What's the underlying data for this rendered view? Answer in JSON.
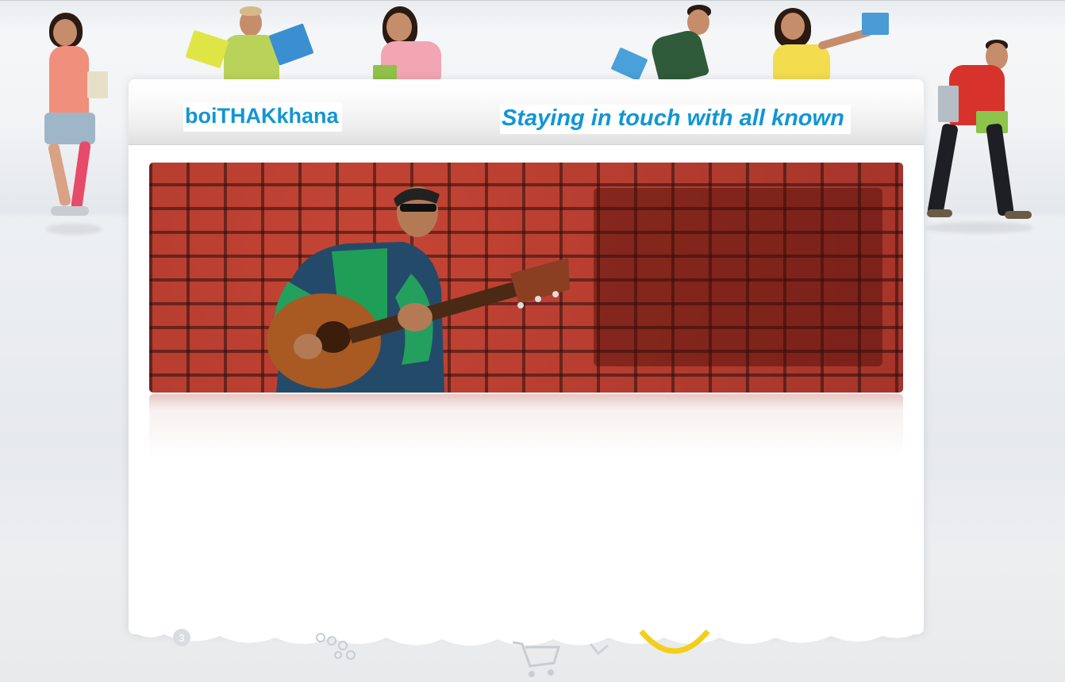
{
  "site": {
    "title": "boiTHAKkhana",
    "tagline": "Staying in touch with all known"
  },
  "colors": {
    "accent": "#1296d4",
    "brick": "#a9362a",
    "background": "#eceef0",
    "card": "#ffffff"
  },
  "banner": {
    "subject": "guitarist-on-brick-wall"
  },
  "decor": {
    "people_count": 7,
    "bottom_icons": [
      "cloud-border",
      "number-3-icon",
      "dots-icon",
      "shopping-cart-icon",
      "ring-icon"
    ]
  }
}
